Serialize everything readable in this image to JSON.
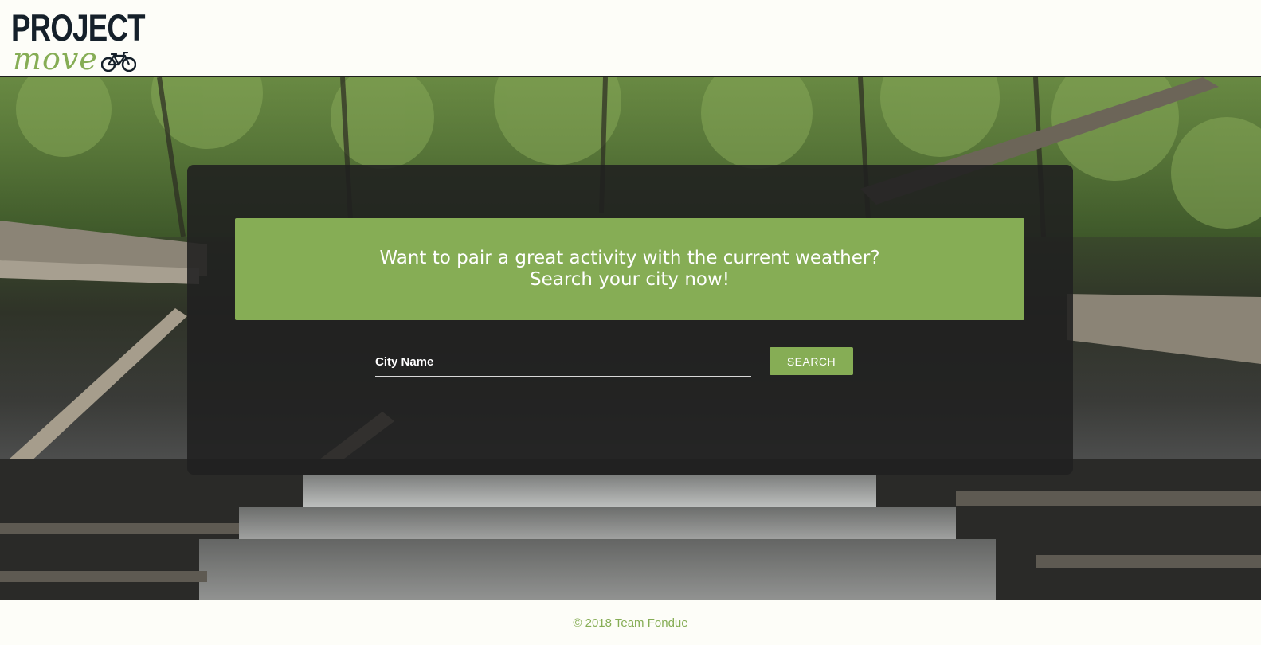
{
  "header": {
    "logo_word": "PROJECT",
    "logo_script": "move",
    "logo_icon": "bicycle-icon"
  },
  "hero": {
    "background": "forest-waterfall-photo",
    "banner_line_1": "Want to pair a great activity with the current weather?",
    "banner_line_2": "Search your city now!",
    "search": {
      "placeholder": "City Name",
      "value": "",
      "button_label": "SEARCH"
    }
  },
  "footer": {
    "text": "© 2018 Team Fondue"
  },
  "colors": {
    "accent": "#86ad55",
    "logo_dark": "#15202a",
    "panel": "#202020",
    "page_bg": "#fdfdf8"
  }
}
